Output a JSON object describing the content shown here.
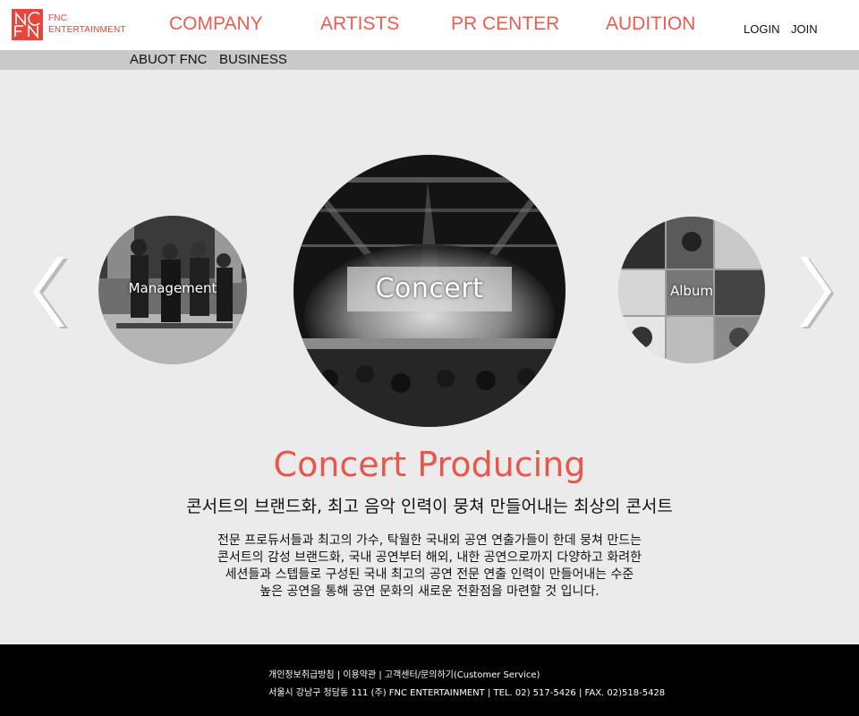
{
  "header": {
    "logo_line1": "FNC",
    "logo_line2": "ENTERTAINMENT",
    "nav": [
      "COMPANY",
      "ARTISTS",
      "PR CENTER",
      "AUDITION"
    ],
    "login": "LOGIN",
    "join": "JOIN"
  },
  "subnav": {
    "items": [
      "ABUOT FNC",
      "BUSINESS"
    ]
  },
  "carousel": {
    "prev_icon": "chevron-left-icon",
    "next_icon": "chevron-right-icon",
    "items": [
      {
        "label": "Management"
      },
      {
        "label": "Concert"
      },
      {
        "label": "Album"
      }
    ]
  },
  "content": {
    "title": "Concert Producing",
    "subtitle": "콘서트의 브랜드화, 최고 음악 인력이 뭉쳐 만들어내는 최상의 콘서트",
    "description": [
      "전문 프로듀서들과 최고의 가수, 탁월한 국내외 공연 연출가들이 한데 뭉쳐 만드는",
      "콘서트의 감성 브랜드화, 국내 공연부터 해외, 내한 공연으로까지 다양하고 화려한",
      "세션들과 스텝들로 구성된 국내 최고의 공연 전문 연출 인력이 만들어내는 수준",
      "높은 공연을 통해 공연 문화의 새로운 전환점을 마련할 것 입니다."
    ]
  },
  "footer": {
    "links": [
      "개인정보취급방침",
      "이용약관",
      "고객센터/문의하기(Customer Service)"
    ],
    "separator": " | ",
    "address": "서울시 강남구 청담동 111 (주) FNC ENTERTAINMENT  | TEL. 02) 517-5426  |  FAX. 02)518-5428"
  },
  "colors": {
    "brand": "#e8453c",
    "nav": "#ee5b52",
    "title": "#e8574c"
  }
}
